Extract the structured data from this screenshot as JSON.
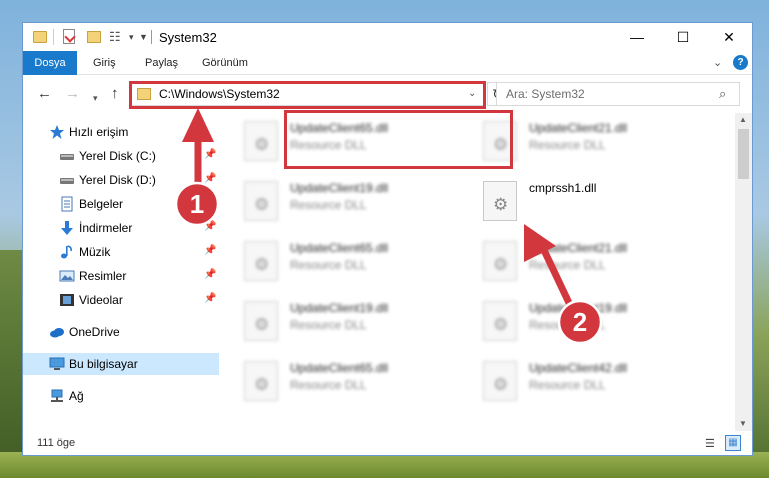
{
  "titlebar": {
    "title": "System32",
    "minimize": "—",
    "maximize": "☐",
    "close": "✕"
  },
  "ribbon": {
    "tabs": [
      "Dosya",
      "Giriş",
      "Paylaş",
      "Görünüm"
    ],
    "help": "?"
  },
  "navigation": {
    "address": "C:\\Windows\\System32",
    "search_placeholder": "Ara: System32"
  },
  "sidebar": {
    "items": [
      {
        "label": "Hızlı erişim",
        "icon": "star-icon"
      },
      {
        "label": "Yerel Disk (C:)",
        "icon": "drive-icon",
        "pinned": true
      },
      {
        "label": "Yerel Disk (D:)",
        "icon": "drive-icon",
        "pinned": true
      },
      {
        "label": "Belgeler",
        "icon": "documents-icon",
        "pinned": true
      },
      {
        "label": "İndirmeler",
        "icon": "download-icon",
        "pinned": true
      },
      {
        "label": "Müzik",
        "icon": "music-icon",
        "pinned": true
      },
      {
        "label": "Resimler",
        "icon": "pictures-icon",
        "pinned": true
      },
      {
        "label": "Videolar",
        "icon": "video-icon",
        "pinned": true
      },
      {
        "label": "OneDrive",
        "icon": "cloud-icon"
      },
      {
        "label": "Bu bilgisayar",
        "icon": "computer-icon",
        "selected": true
      },
      {
        "label": "Ağ",
        "icon": "network-icon"
      }
    ]
  },
  "files": [
    {
      "name": "UpdateClient65.dll",
      "type": "Resource DLL"
    },
    {
      "name": "UpdateClient21.dll",
      "type": "Resource DLL"
    },
    {
      "name": "UpdateClient19.dll",
      "type": "Resource DLL"
    },
    {
      "name": "cmprssh1.dll",
      "type": ""
    },
    {
      "name": "UpdateClient65.dll",
      "type": "Resource DLL"
    },
    {
      "name": "UpdateClient21.dll",
      "type": "Resource DLL"
    },
    {
      "name": "UpdateClient19.dll",
      "type": "Resource DLL"
    },
    {
      "name": "UpdateClient19.dll",
      "type": "Resource DLL"
    },
    {
      "name": "UpdateClient65.dll",
      "type": "Resource DLL"
    },
    {
      "name": "UpdateClient42.dll",
      "type": "Resource DLL"
    }
  ],
  "status": {
    "count": "111 öge"
  },
  "annotations": {
    "step1": "1",
    "step2": "2",
    "color": "#d2373d"
  }
}
